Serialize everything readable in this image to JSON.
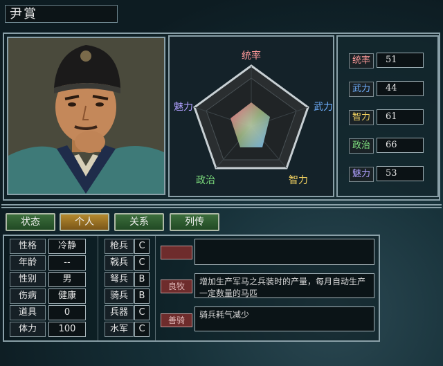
{
  "character": {
    "name": "尹賞"
  },
  "radar": {
    "labels": {
      "lead": "统率",
      "war": "武力",
      "int": "智力",
      "pol": "政治",
      "chr": "魅力"
    }
  },
  "stats": [
    {
      "label": "统率",
      "value": "51",
      "color": "#ff9a9a"
    },
    {
      "label": "武力",
      "value": "44",
      "color": "#6fb0ff"
    },
    {
      "label": "智力",
      "value": "61",
      "color": "#f0d060"
    },
    {
      "label": "政治",
      "value": "66",
      "color": "#7ee07e"
    },
    {
      "label": "魅力",
      "value": "53",
      "color": "#b0a0ff"
    }
  ],
  "tabs": [
    {
      "label": "状态"
    },
    {
      "label": "个人"
    },
    {
      "label": "关系"
    },
    {
      "label": "列传"
    }
  ],
  "profile": [
    {
      "label": "性格",
      "value": "冷静"
    },
    {
      "label": "年龄",
      "value": "--"
    },
    {
      "label": "性别",
      "value": "男"
    },
    {
      "label": "伤病",
      "value": "健康"
    },
    {
      "label": "道具",
      "value": "0"
    },
    {
      "label": "体力",
      "value": "100"
    }
  ],
  "aptitude": [
    {
      "label": "枪兵",
      "value": "C"
    },
    {
      "label": "戟兵",
      "value": "C"
    },
    {
      "label": "弩兵",
      "value": "B"
    },
    {
      "label": "骑兵",
      "value": "B"
    },
    {
      "label": "兵器",
      "value": "C"
    },
    {
      "label": "水军",
      "value": "C"
    }
  ],
  "skills": [
    {
      "name": "",
      "desc": ""
    },
    {
      "name": "良牧",
      "desc": "增加生产军马之兵装时的产量，每月自动生产一定数量的马匹"
    },
    {
      "name": "善骑",
      "desc": "骑兵耗气减少"
    }
  ]
}
